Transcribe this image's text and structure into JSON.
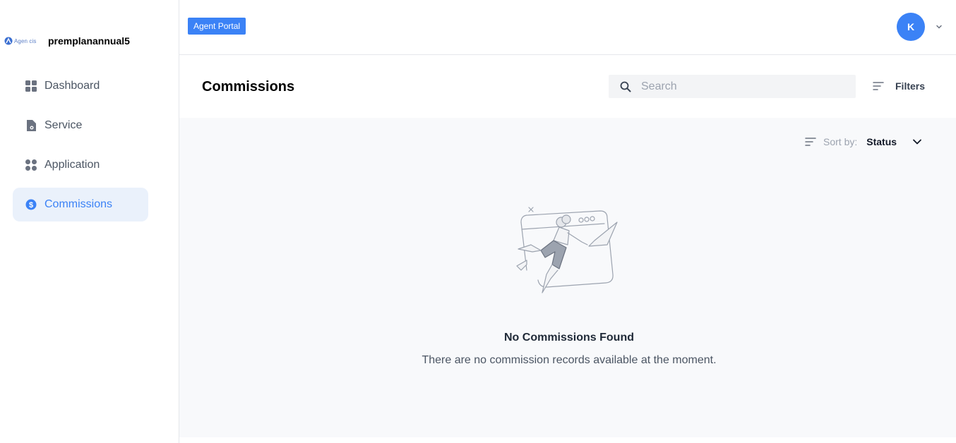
{
  "brand": {
    "logo_text": "Agen cis",
    "account_name": "premplanannual5"
  },
  "sidebar": {
    "items": [
      {
        "label": "Dashboard",
        "icon": "dashboard-grid-icon",
        "active": false
      },
      {
        "label": "Service",
        "icon": "document-icon",
        "active": false
      },
      {
        "label": "Application",
        "icon": "apps-grid-icon",
        "active": false
      },
      {
        "label": "Commissions",
        "icon": "dollar-circle-icon",
        "active": true
      }
    ]
  },
  "topbar": {
    "portal_badge": "Agent Portal",
    "avatar_initial": "K"
  },
  "header": {
    "title": "Commissions",
    "search_placeholder": "Search",
    "filters_label": "Filters"
  },
  "sort": {
    "label": "Sort by:",
    "value": "Status"
  },
  "empty_state": {
    "title": "No Commissions Found",
    "message": "There are no commission records available at the moment."
  },
  "colors": {
    "accent": "#3b82f6",
    "active_bg": "#eaf1fb",
    "content_bg": "#f8f9fb"
  }
}
